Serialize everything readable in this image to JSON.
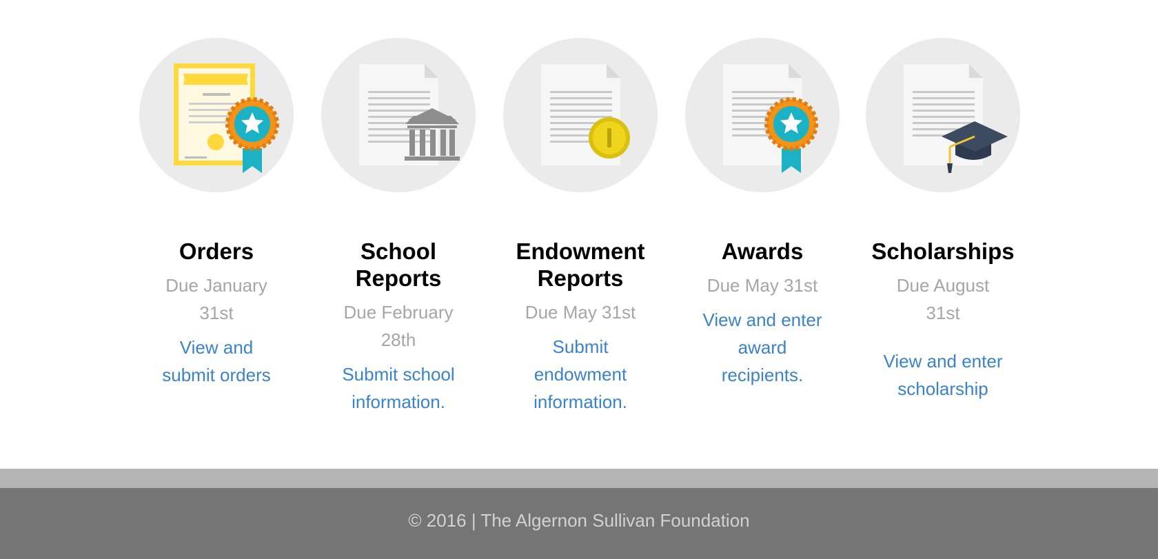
{
  "cards": [
    {
      "title": "Orders",
      "due": "Due January\n31st",
      "link": "View and\nsubmit orders"
    },
    {
      "title": "School\nReports",
      "due": "Due February\n28th",
      "link": "Submit school\ninformation."
    },
    {
      "title": "Endowment\nReports",
      "due": "Due May 31st",
      "link": "Submit\nendowment\ninformation."
    },
    {
      "title": "Awards",
      "due": "Due May 31st",
      "link": "View and enter\naward\nrecipients."
    },
    {
      "title": "Scholarships",
      "due": "Due August\n31st",
      "link": "View and enter\nscholarship"
    }
  ],
  "icons": [
    "certificate-icon",
    "school-report-icon",
    "endowment-report-icon",
    "award-ribbon-icon",
    "graduation-cap-icon"
  ],
  "colors": {
    "link": "#3a83c8",
    "due": "#a6a6a6",
    "footer": "#757575",
    "footer_band": "#b4b4b4"
  },
  "footer": {
    "text": "© 2016 | The Algernon Sullivan Foundation"
  }
}
